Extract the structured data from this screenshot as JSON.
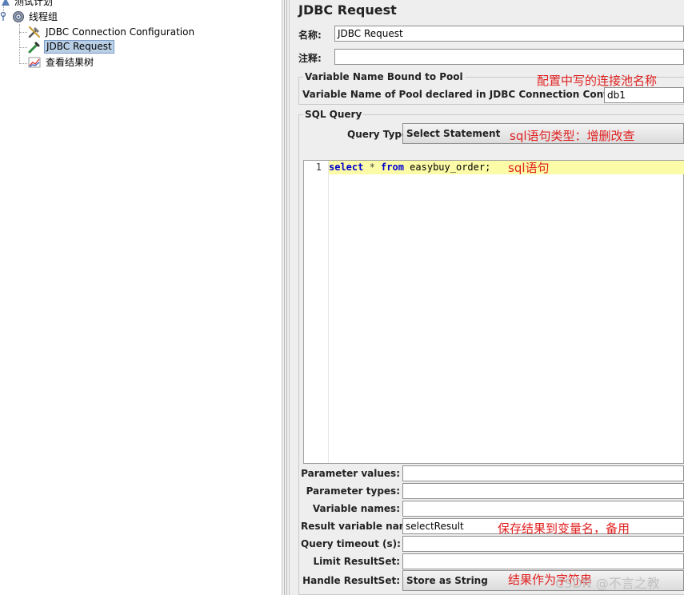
{
  "tree": {
    "items": [
      {
        "label": "测试计划"
      },
      {
        "label": "线程组"
      },
      {
        "label": "JDBC Connection Configuration"
      },
      {
        "label": "JDBC Request"
      },
      {
        "label": "查看结果树"
      }
    ]
  },
  "panel": {
    "title": "JDBC Request",
    "name_label": "名称:",
    "name_value": "JDBC Request",
    "comment_label": "注释:",
    "comment_value": "",
    "pool_group_title": "Variable Name Bound to Pool",
    "pool_label": "Variable Name of Pool declared in JDBC Connection Configuration:",
    "pool_value": "db1",
    "sql_group_title": "SQL Query",
    "query_type_label": "Query Type:",
    "query_type_value": "Select Statement",
    "editor": {
      "line_number": "1",
      "kw1": "select",
      "op": " * ",
      "kw2": "from",
      "rest": " easybuy_order;"
    },
    "params": {
      "parameter_values_label": "Parameter values:",
      "parameter_values": "",
      "parameter_types_label": "Parameter types:",
      "parameter_types": "",
      "variable_names_label": "Variable names:",
      "variable_names": "",
      "result_variable_label": "Result variable name:",
      "result_variable": "selectResult",
      "query_timeout_label": "Query timeout (s):",
      "query_timeout": "",
      "limit_resultset_label": "Limit ResultSet:",
      "limit_resultset": "",
      "handle_resultset_label": "Handle ResultSet:",
      "handle_resultset": "Store as String"
    }
  },
  "annotations": {
    "pool_note": "配置中写的连接池名称",
    "query_type_note": "sql语句类型：增删改查",
    "sql_note": "sql语句",
    "result_note": "保存结果到变量名，备用",
    "handle_note": "结果作为字符串",
    "watermark": "CSDN @不言之教"
  },
  "colors": {
    "annotation": "#e02020",
    "keyword": "#0000d0",
    "current_line": "#fcfca8",
    "selection": "#b8cfe5"
  }
}
